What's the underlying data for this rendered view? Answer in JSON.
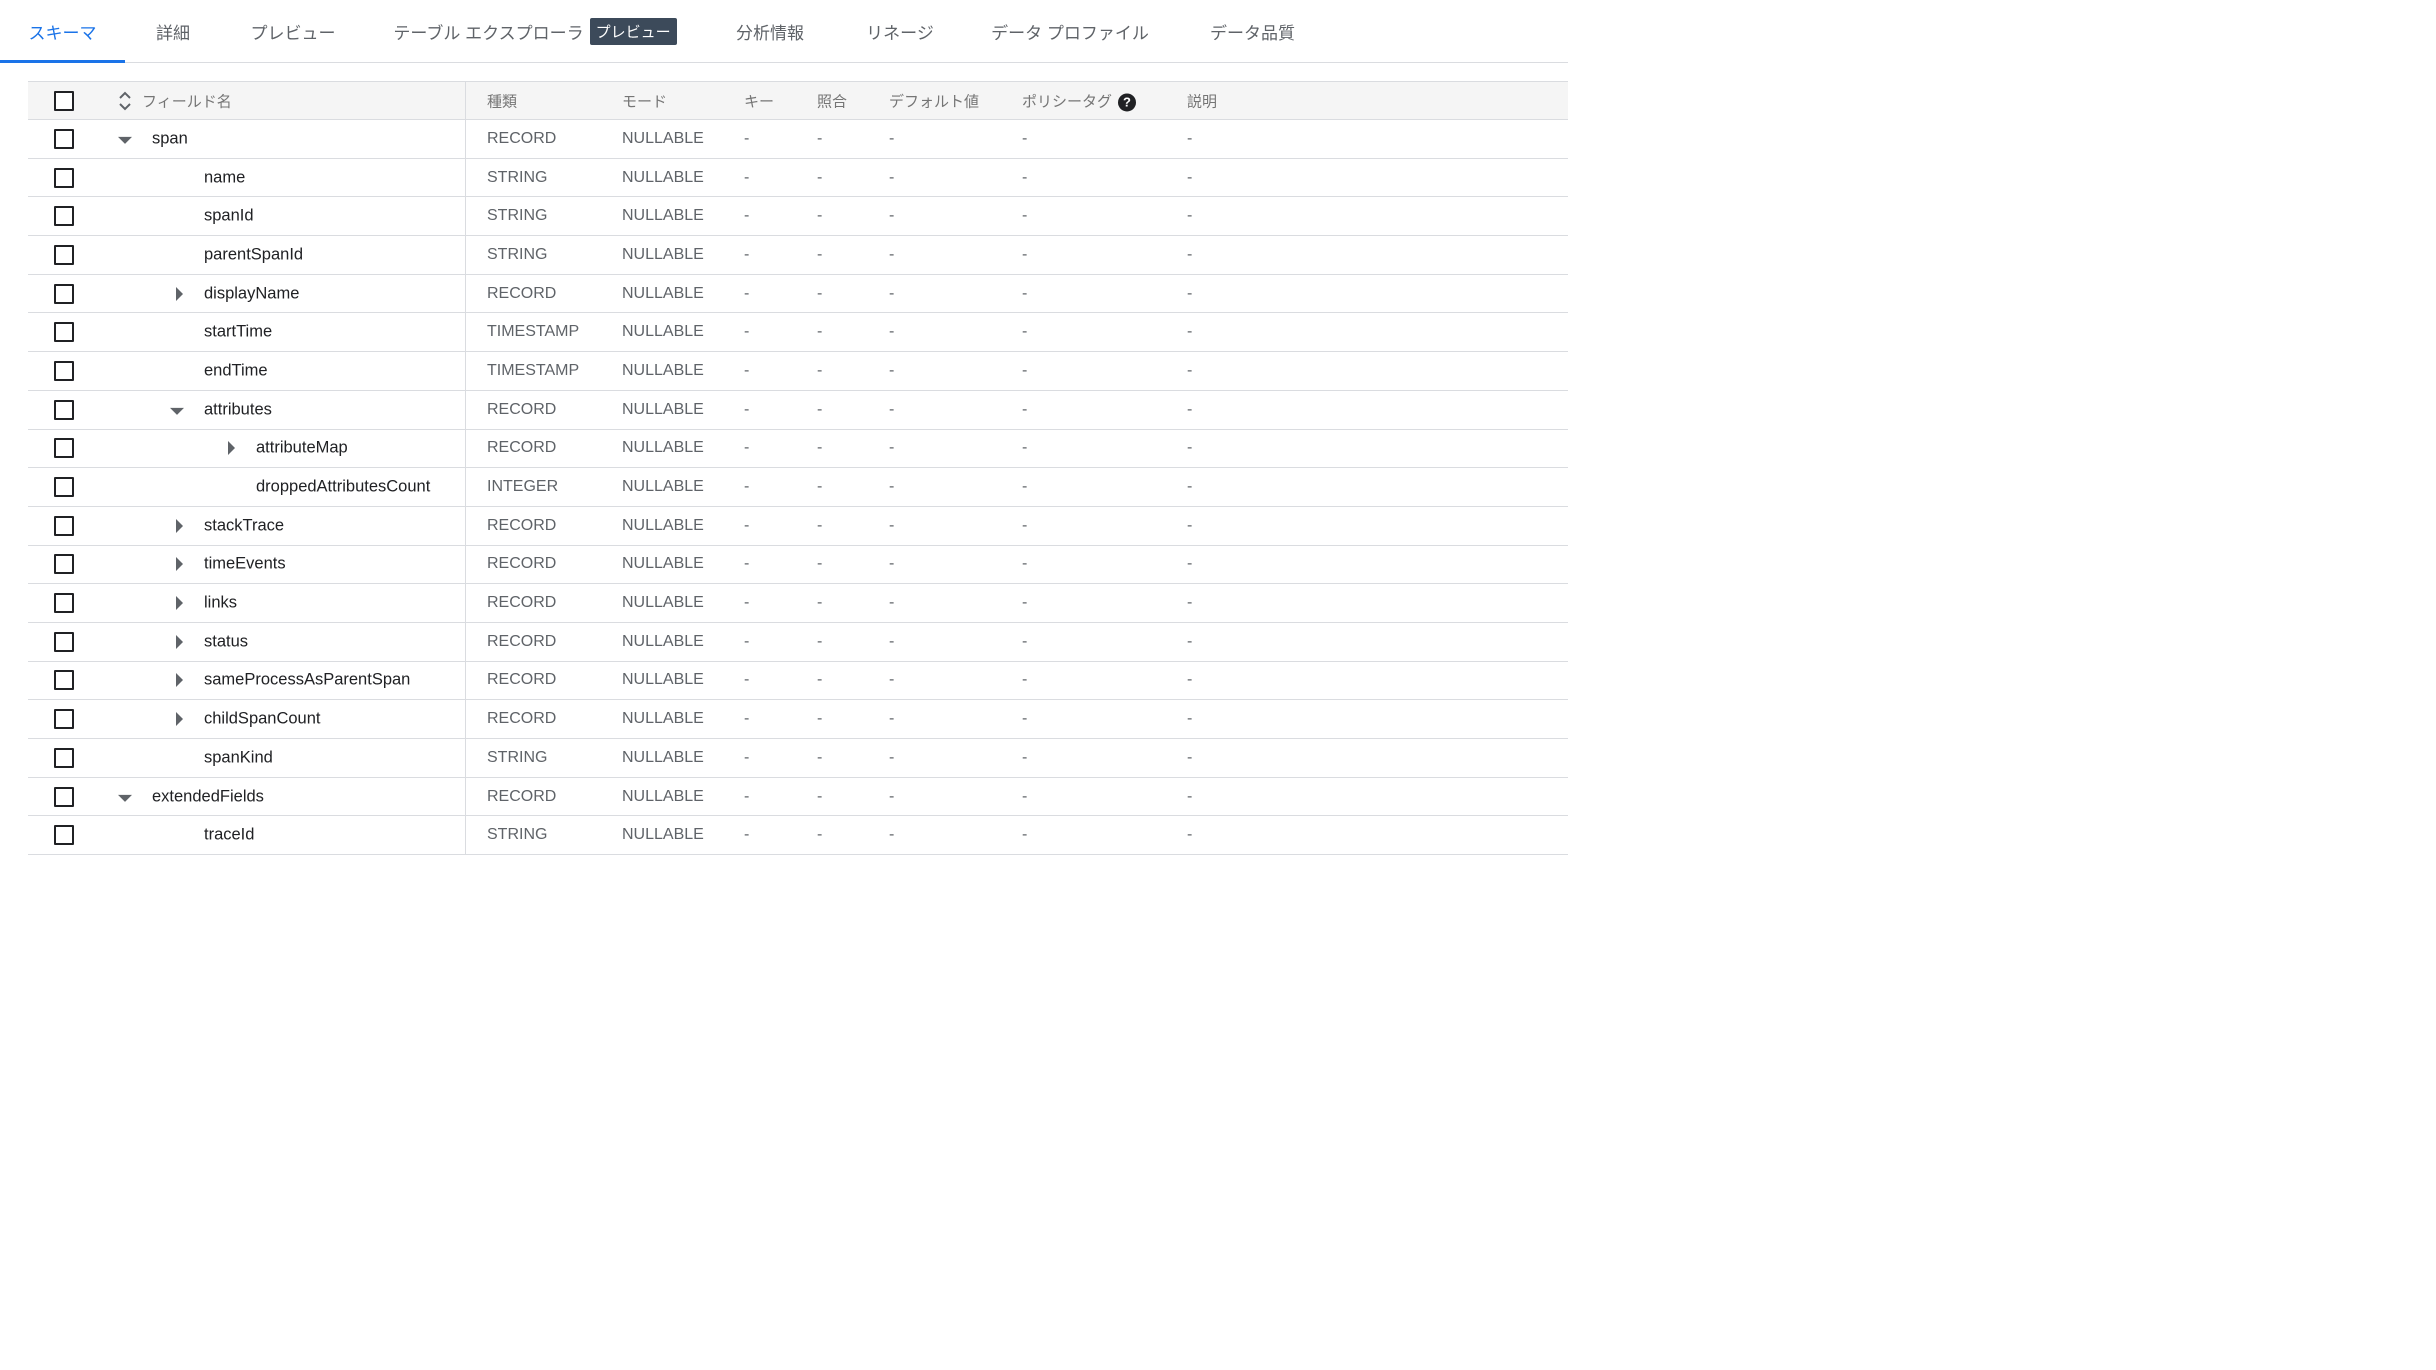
{
  "tabs": [
    {
      "label": "スキーマ",
      "active": true
    },
    {
      "label": "詳細"
    },
    {
      "label": "プレビュー"
    },
    {
      "label": "テーブル エクスプローラ",
      "badge": "プレビュー"
    },
    {
      "label": "分析情報"
    },
    {
      "label": "リネージ"
    },
    {
      "label": "データ プロファイル"
    },
    {
      "label": "データ品質"
    }
  ],
  "columns": {
    "field": "フィールド名",
    "type": "種類",
    "mode": "モード",
    "key": "キー",
    "collation": "照合",
    "default": "デフォルト値",
    "policy": "ポリシータグ",
    "description": "説明"
  },
  "help_glyph": "?",
  "rows": [
    {
      "name": "span",
      "level": 0,
      "expand": "open",
      "type": "RECORD",
      "mode": "NULLABLE",
      "key": "-",
      "collation": "-",
      "default": "-",
      "policy": "-",
      "description": "-"
    },
    {
      "name": "name",
      "level": 1,
      "expand": "none",
      "type": "STRING",
      "mode": "NULLABLE",
      "key": "-",
      "collation": "-",
      "default": "-",
      "policy": "-",
      "description": "-"
    },
    {
      "name": "spanId",
      "level": 1,
      "expand": "none",
      "type": "STRING",
      "mode": "NULLABLE",
      "key": "-",
      "collation": "-",
      "default": "-",
      "policy": "-",
      "description": "-"
    },
    {
      "name": "parentSpanId",
      "level": 1,
      "expand": "none",
      "type": "STRING",
      "mode": "NULLABLE",
      "key": "-",
      "collation": "-",
      "default": "-",
      "policy": "-",
      "description": "-"
    },
    {
      "name": "displayName",
      "level": 1,
      "expand": "closed",
      "type": "RECORD",
      "mode": "NULLABLE",
      "key": "-",
      "collation": "-",
      "default": "-",
      "policy": "-",
      "description": "-"
    },
    {
      "name": "startTime",
      "level": 1,
      "expand": "none",
      "type": "TIMESTAMP",
      "mode": "NULLABLE",
      "key": "-",
      "collation": "-",
      "default": "-",
      "policy": "-",
      "description": "-"
    },
    {
      "name": "endTime",
      "level": 1,
      "expand": "none",
      "type": "TIMESTAMP",
      "mode": "NULLABLE",
      "key": "-",
      "collation": "-",
      "default": "-",
      "policy": "-",
      "description": "-"
    },
    {
      "name": "attributes",
      "level": 1,
      "expand": "open",
      "type": "RECORD",
      "mode": "NULLABLE",
      "key": "-",
      "collation": "-",
      "default": "-",
      "policy": "-",
      "description": "-"
    },
    {
      "name": "attributeMap",
      "level": 2,
      "expand": "closed",
      "type": "RECORD",
      "mode": "NULLABLE",
      "key": "-",
      "collation": "-",
      "default": "-",
      "policy": "-",
      "description": "-"
    },
    {
      "name": "droppedAttributesCount",
      "level": 2,
      "expand": "none",
      "type": "INTEGER",
      "mode": "NULLABLE",
      "key": "-",
      "collation": "-",
      "default": "-",
      "policy": "-",
      "description": "-"
    },
    {
      "name": "stackTrace",
      "level": 1,
      "expand": "closed",
      "type": "RECORD",
      "mode": "NULLABLE",
      "key": "-",
      "collation": "-",
      "default": "-",
      "policy": "-",
      "description": "-"
    },
    {
      "name": "timeEvents",
      "level": 1,
      "expand": "closed",
      "type": "RECORD",
      "mode": "NULLABLE",
      "key": "-",
      "collation": "-",
      "default": "-",
      "policy": "-",
      "description": "-"
    },
    {
      "name": "links",
      "level": 1,
      "expand": "closed",
      "type": "RECORD",
      "mode": "NULLABLE",
      "key": "-",
      "collation": "-",
      "default": "-",
      "policy": "-",
      "description": "-"
    },
    {
      "name": "status",
      "level": 1,
      "expand": "closed",
      "type": "RECORD",
      "mode": "NULLABLE",
      "key": "-",
      "collation": "-",
      "default": "-",
      "policy": "-",
      "description": "-"
    },
    {
      "name": "sameProcessAsParentSpan",
      "level": 1,
      "expand": "closed",
      "type": "RECORD",
      "mode": "NULLABLE",
      "key": "-",
      "collation": "-",
      "default": "-",
      "policy": "-",
      "description": "-"
    },
    {
      "name": "childSpanCount",
      "level": 1,
      "expand": "closed",
      "type": "RECORD",
      "mode": "NULLABLE",
      "key": "-",
      "collation": "-",
      "default": "-",
      "policy": "-",
      "description": "-"
    },
    {
      "name": "spanKind",
      "level": 1,
      "expand": "none",
      "type": "STRING",
      "mode": "NULLABLE",
      "key": "-",
      "collation": "-",
      "default": "-",
      "policy": "-",
      "description": "-"
    },
    {
      "name": "extendedFields",
      "level": 0,
      "expand": "open",
      "type": "RECORD",
      "mode": "NULLABLE",
      "key": "-",
      "collation": "-",
      "default": "-",
      "policy": "-",
      "description": "-"
    },
    {
      "name": "traceId",
      "level": 1,
      "expand": "none",
      "type": "STRING",
      "mode": "NULLABLE",
      "key": "-",
      "collation": "-",
      "default": "-",
      "policy": "-",
      "description": "-"
    }
  ]
}
